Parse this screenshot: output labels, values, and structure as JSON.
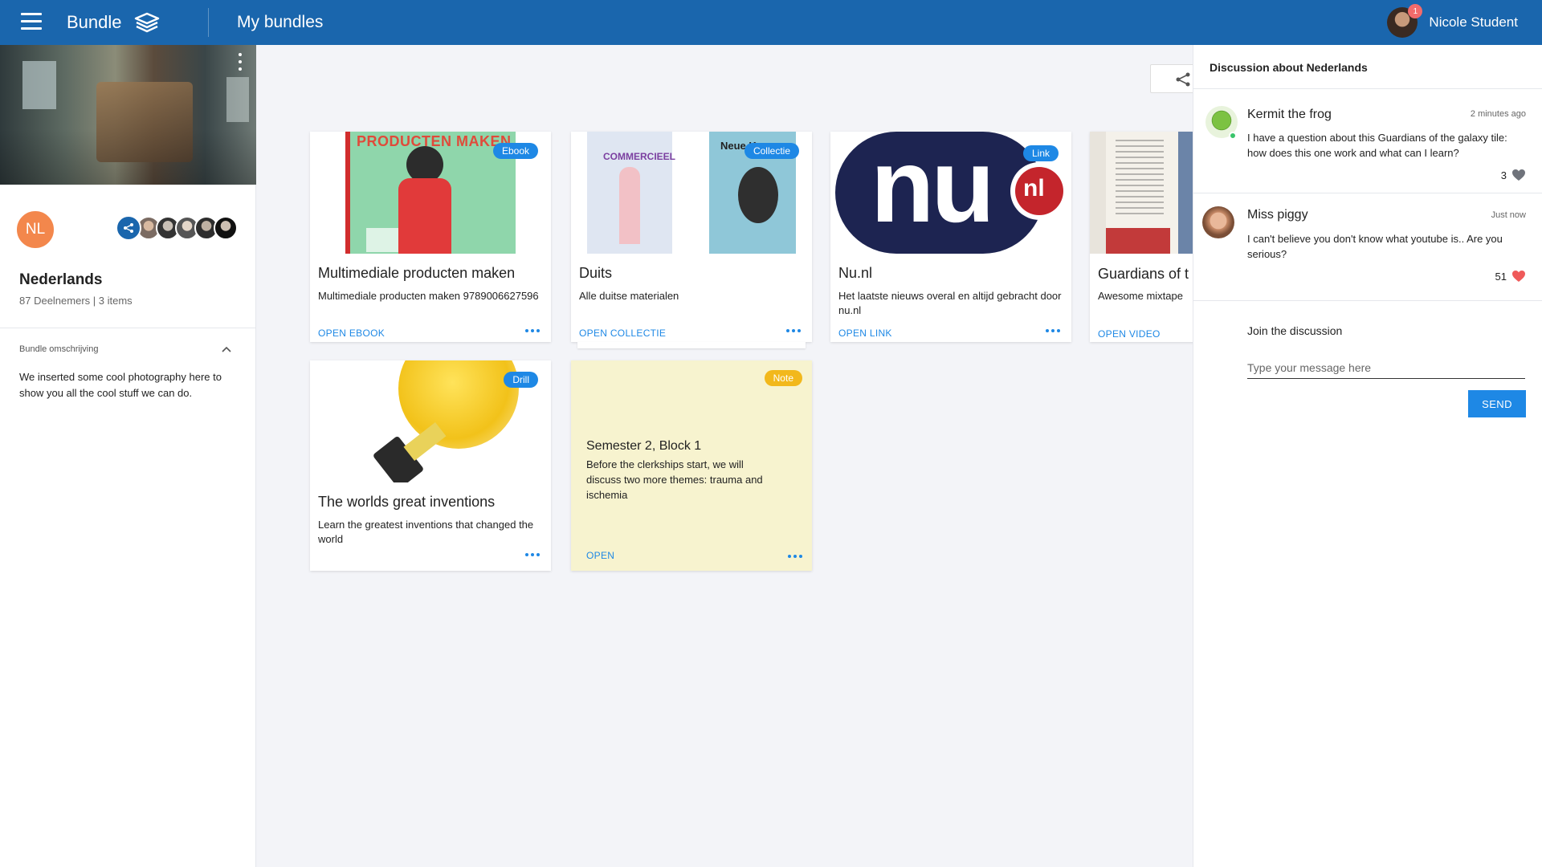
{
  "topbar": {
    "brand": "Bundle",
    "page_title": "My bundles",
    "user_name": "Nicole Student",
    "notification_count": "1"
  },
  "sidebar": {
    "initials": "NL",
    "bundle_name": "Nederlands",
    "meta": "87 Deelnemers | 3 items",
    "description_label": "Bundle omschrijving",
    "description": "We inserted some cool photography here to show you all the cool stuff we can do."
  },
  "cards": [
    {
      "badge": "Ebook",
      "title": "Multimediale producten maken",
      "desc": "Multimediale producten maken 9789006627596",
      "action": "OPEN EBOOK",
      "thumb_text": "PRODUCTEN MAKEN"
    },
    {
      "badge": "Collectie",
      "title": "Duits",
      "desc": "Alle duitse materialen",
      "action": "OPEN COLLECTIE",
      "thumb_text_a": "COMMERCIEEL",
      "thumb_text_b": "Neue Ko"
    },
    {
      "badge": "Link",
      "title": "Nu.nl",
      "desc": "Het laatste nieuws overal en altijd gebracht door nu.nl",
      "action": "OPEN LINK",
      "thumb_text_a": "nu",
      "thumb_text_b": "nl"
    },
    {
      "badge": "",
      "title": "Guardians of t",
      "desc": "Awesome mixtape",
      "action": "OPEN VIDEO"
    },
    {
      "badge": "Drill",
      "title": "The worlds great inventions",
      "desc": "Learn the greatest inventions that changed the world",
      "action": ""
    },
    {
      "badge": "Note",
      "title": "Semester 2, Block 1",
      "desc": "Before the clerkships start, we will discuss two more themes: trauma and ischemia",
      "action": "OPEN"
    }
  ],
  "discussion": {
    "title": "Discussion about Nederlands",
    "messages": [
      {
        "author": "Kermit the frog",
        "time": "2 minutes ago",
        "text": "I have a question about this Guardians of the galaxy tile: how does this one work and what can I learn?",
        "likes": "3"
      },
      {
        "author": "Miss piggy",
        "time": "Just now",
        "text": "I can't believe you don't know what youtube is.. Are you serious?",
        "likes": "51"
      }
    ],
    "join_label": "Join the discussion",
    "input_placeholder": "Type your message here",
    "send_label": "SEND"
  },
  "colors": {
    "topbar": "#1a66ad",
    "accent": "#1e88e5",
    "note_bg": "#f7f3cf",
    "note_badge": "#f2b81c",
    "avatar_orange": "#f3874c",
    "like_red": "#ef5a5a"
  }
}
